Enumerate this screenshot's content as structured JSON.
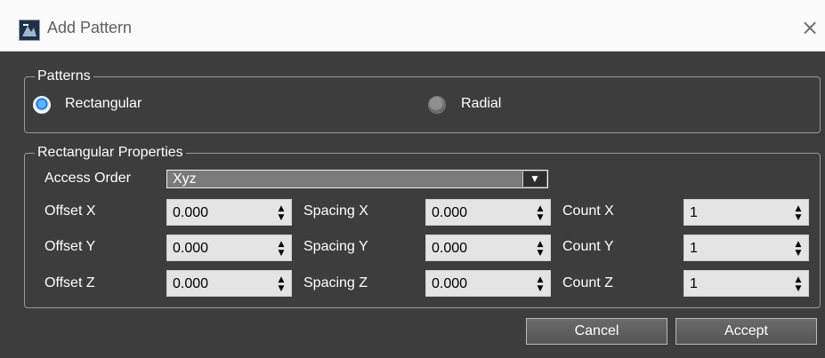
{
  "window": {
    "title": "Add Pattern",
    "app_icon": "app-logo-icon",
    "close_icon": "close-icon"
  },
  "patterns": {
    "legend": "Patterns",
    "options": [
      {
        "label": "Rectangular",
        "selected": true
      },
      {
        "label": "Radial",
        "selected": false
      }
    ]
  },
  "rect_props": {
    "legend": "Rectangular Properties",
    "access_order": {
      "label": "Access Order",
      "value": "Xyz"
    },
    "offset_x": {
      "label": "Offset X",
      "value": "0.000"
    },
    "offset_y": {
      "label": "Offset Y",
      "value": "0.000"
    },
    "offset_z": {
      "label": "Offset Z",
      "value": "0.000"
    },
    "spacing_x": {
      "label": "Spacing X",
      "value": "0.000"
    },
    "spacing_y": {
      "label": "Spacing Y",
      "value": "0.000"
    },
    "spacing_z": {
      "label": "Spacing Z",
      "value": "0.000"
    },
    "count_x": {
      "label": "Count X",
      "value": "1"
    },
    "count_y": {
      "label": "Count Y",
      "value": "1"
    },
    "count_z": {
      "label": "Count Z",
      "value": "1"
    }
  },
  "buttons": {
    "cancel": "Cancel",
    "accept": "Accept"
  },
  "colors": {
    "background": "#3d3d3d",
    "titlebar": "#fbfbfb",
    "field": "#e4e4e4",
    "dropdown": "#7a7a7a",
    "radio_selected": "#2272d9"
  }
}
